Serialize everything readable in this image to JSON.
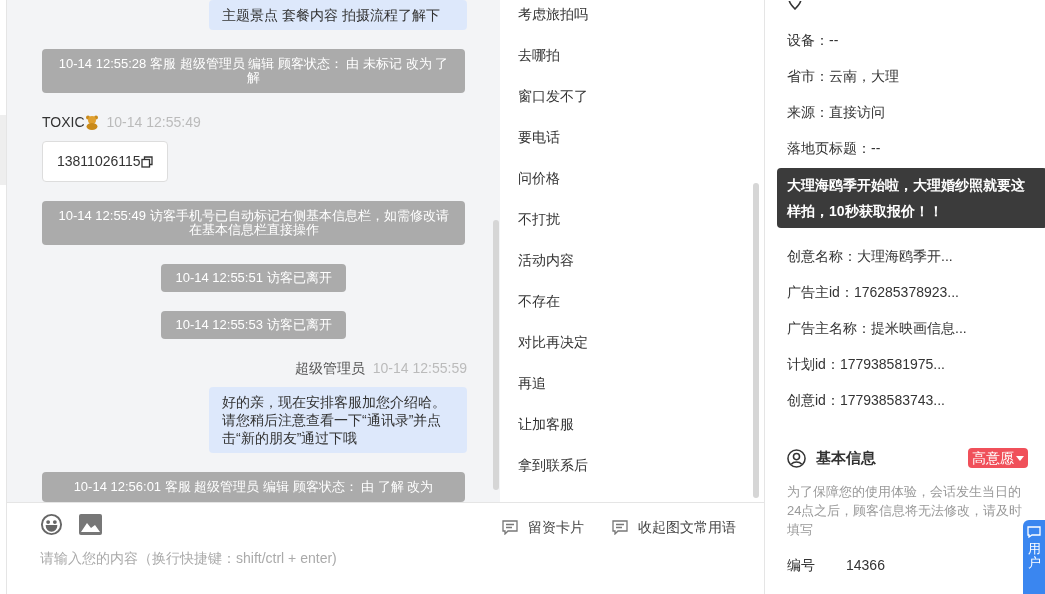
{
  "chat": {
    "messages": [
      {
        "kind": "agent",
        "text": "主题景点 套餐内容 拍摄流程了解下"
      },
      {
        "kind": "event",
        "text": "10-14 12:55:28 客服 超级管理员 编辑 顾客状态： 由 未标记 改为 了解"
      },
      {
        "kind": "visitor",
        "name": "TOXIC",
        "time": "10-14 12:55:49",
        "text": "13811026115"
      },
      {
        "kind": "event",
        "text": "10-14 12:55:49 访客手机号已自动标记右侧基本信息栏，如需修改请在基本信息栏直接操作"
      },
      {
        "kind": "presence",
        "text": "10-14 12:55:51 访客已离开"
      },
      {
        "kind": "presence",
        "text": "10-14 12:55:53 访客已离开"
      },
      {
        "kind": "agent",
        "name": "超级管理员",
        "time": "10-14 12:55:59",
        "text": "好的亲，现在安排客服加您介绍哈。请您稍后注意查看一下“通讯录”并点击“新的朋友”通过下哦"
      },
      {
        "kind": "event",
        "text": "10-14 12:56:01 客服 超级管理员 编辑 顾客状态： 由 了解 改为"
      }
    ],
    "input": {
      "placeholder": "请输入您的内容（换行快捷键：shift/ctrl + enter)"
    }
  },
  "quick_replies": {
    "items": [
      "考虑旅拍吗",
      "去哪拍",
      "窗口发不了",
      "要电话",
      "问价格",
      "不打扰",
      "活动内容",
      "不存在",
      "对比再决定",
      "再追",
      "让加客服",
      "拿到联系后"
    ],
    "actions": [
      "留资卡片",
      "收起图文常用语"
    ]
  },
  "source_info": {
    "rows": [
      {
        "kind": "row",
        "text": "设备：--"
      },
      {
        "kind": "row",
        "text": "省市：云南，大理"
      },
      {
        "kind": "row",
        "text": "来源：直接访问"
      },
      {
        "kind": "row",
        "text": "落地页标题：--"
      },
      {
        "kind": "tooltip",
        "text": "大理海鸥季开始啦，大理婚纱照就要这样拍，10秒获取报价！！"
      },
      {
        "kind": "row",
        "text": "创意名称：大理海鸥季开..."
      },
      {
        "kind": "row",
        "text": "广告主id：176285378923..."
      },
      {
        "kind": "row",
        "text": "广告主名称：提米映画信息..."
      },
      {
        "kind": "row",
        "text": "计划id：177938581975..."
      },
      {
        "kind": "row",
        "text": "创意id：177938583743..."
      }
    ]
  },
  "basic_info": {
    "title": "基本信息",
    "intent": "高意愿",
    "note": "为了保障您的使用体验，会话发生当日的24点之后，顾客信息将无法修改，请及时填写",
    "fields": [
      {
        "label": "编号",
        "value": "14366"
      }
    ]
  },
  "feedback": {
    "label": "用户"
  }
}
